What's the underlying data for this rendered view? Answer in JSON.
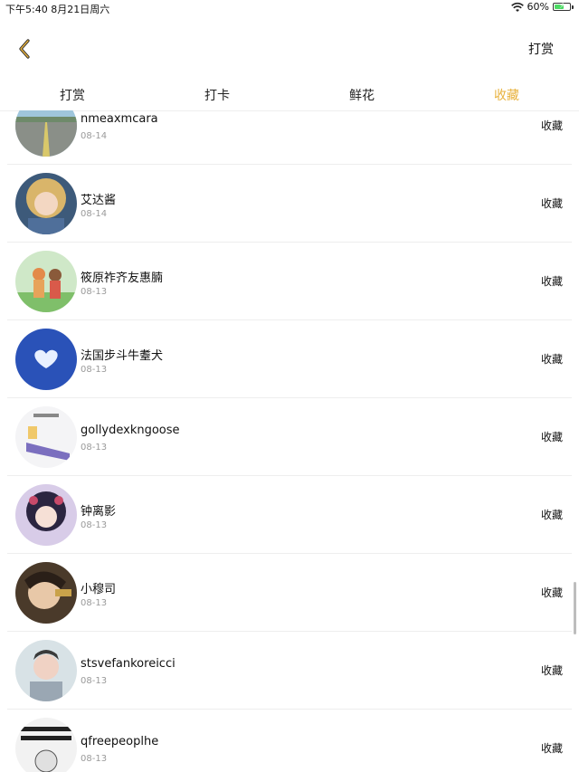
{
  "status_bar": {
    "time_date": "下午5:40  8月21日周六",
    "battery": "60%",
    "battery_level": 0.6
  },
  "header": {
    "back_icon": "chevron-left-icon",
    "action_label": "打赏",
    "accent_color": "#e8b23d"
  },
  "tabs": [
    {
      "label": "打赏",
      "active": false
    },
    {
      "label": "打卡",
      "active": false
    },
    {
      "label": "鲜花",
      "active": false
    },
    {
      "label": "收藏",
      "active": true
    }
  ],
  "list": {
    "items": [
      {
        "name": "nmeaxmcara",
        "date": "08-14",
        "action": "收藏",
        "avatar_theme": "landscape-road"
      },
      {
        "name": "艾达酱",
        "date": "08-14",
        "action": "收藏",
        "avatar_theme": "anime-girl"
      },
      {
        "name": "筱原祚齐友惠腩",
        "date": "08-13",
        "action": "收藏",
        "avatar_theme": "couple-illustration"
      },
      {
        "name": "法国步斗牛耋犬",
        "date": "08-13",
        "action": "收藏",
        "avatar_theme": "cloud-heart"
      },
      {
        "name": "gollydexkngoose",
        "date": "08-13",
        "action": "收藏",
        "avatar_theme": "sketch"
      },
      {
        "name": "钟离影",
        "date": "08-13",
        "action": "收藏",
        "avatar_theme": "anime-girl-dark"
      },
      {
        "name": "小穆司",
        "date": "08-13",
        "action": "收藏",
        "avatar_theme": "anime-boy"
      },
      {
        "name": "stsvefankoreicci",
        "date": "08-13",
        "action": "收藏",
        "avatar_theme": "photo-boy"
      },
      {
        "name": "qfreepeoplhe",
        "date": "08-13",
        "action": "收藏",
        "avatar_theme": "meme-text"
      }
    ]
  }
}
